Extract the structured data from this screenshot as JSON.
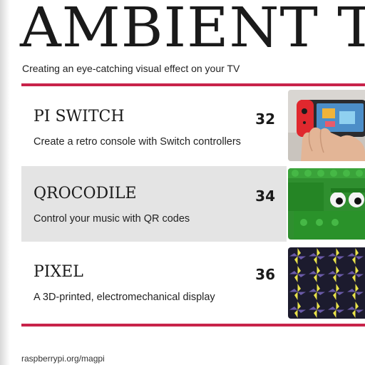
{
  "header": {
    "big_title": "AMBIENT T",
    "subtitle": "Creating an eye-catching visual effect on your TV"
  },
  "contents": [
    {
      "title": "PI SWITCH",
      "page": "32",
      "description": "Create a retro console with Switch controllers",
      "thumbnail": "nintendo-switch-photo"
    },
    {
      "title": "QROCODILE",
      "page": "34",
      "description": "Control your music with QR codes",
      "thumbnail": "lego-crocodile-photo"
    },
    {
      "title": "PIXEL",
      "page": "36",
      "description": "A 3D-printed, electromechanical display",
      "thumbnail": "pixel-display-photo"
    }
  ],
  "footer": {
    "url": "raspberrypi.org/magpi"
  },
  "colors": {
    "accent": "#c8234a",
    "shaded_row": "#e4e4e4",
    "text": "#1a1a1a"
  }
}
